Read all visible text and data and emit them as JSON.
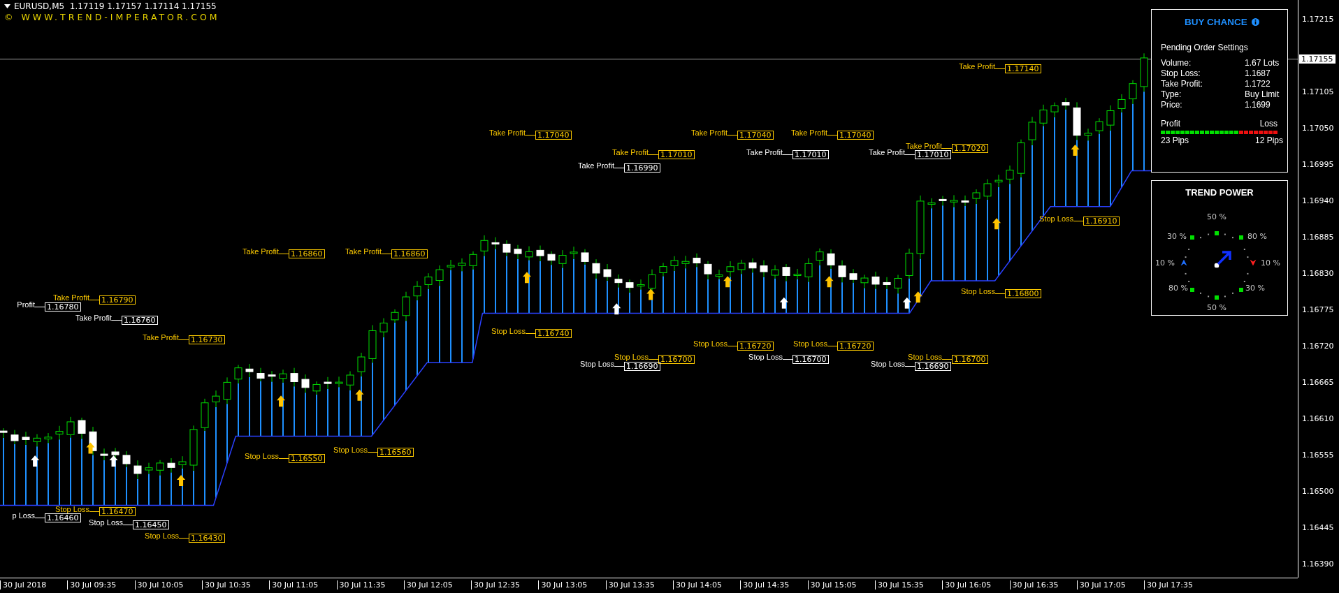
{
  "symbol_header": {
    "text": "EURUSD,M5  1.17119 1.17157 1.17114 1.17155",
    "copyright": "© WWW.TREND-IMPERATOR.COM"
  },
  "levels": [
    {
      "label": "Profit",
      "value": "1.16780",
      "color": "#ffffff"
    },
    {
      "label": "Take Profit",
      "value": "1.16790",
      "color": "#ffcc00"
    },
    {
      "label": "Take Profit",
      "value": "1.16760",
      "color": "#ffffff"
    },
    {
      "label": "Take Profit",
      "value": "1.16730",
      "color": "#ffcc00"
    },
    {
      "label": "Take Profit",
      "value": "1.16860",
      "color": "#ffcc00"
    },
    {
      "label": "Take Profit",
      "value": "1.16860",
      "color": "#ffcc00"
    },
    {
      "label": "Take Profit",
      "value": "1.17040",
      "color": "#ffcc00"
    },
    {
      "label": "Take Profit",
      "value": "1.17010",
      "color": "#ffcc00"
    },
    {
      "label": "Take Profit",
      "value": "1.16990",
      "color": "#ffffff"
    },
    {
      "label": "Take Profit",
      "value": "1.17040",
      "color": "#ffcc00"
    },
    {
      "label": "Take Profit",
      "value": "1.17010",
      "color": "#ffffff"
    },
    {
      "label": "Take Profit",
      "value": "1.17040",
      "color": "#ffcc00"
    },
    {
      "label": "Take Profit",
      "value": "1.17020",
      "color": "#ffcc00"
    },
    {
      "label": "Take Profit",
      "value": "1.17010",
      "color": "#ffffff"
    },
    {
      "label": "Take Profit",
      "value": "1.17140",
      "color": "#ffcc00"
    },
    {
      "label": "Stop Loss",
      "value": "1.16910",
      "color": "#ffcc00"
    },
    {
      "label": "p Loss",
      "value": "1.16460",
      "color": "#ffffff"
    },
    {
      "label": "Stop Loss",
      "value": "1.16470",
      "color": "#ffcc00"
    },
    {
      "label": "Stop Loss",
      "value": "1.16450",
      "color": "#ffffff"
    },
    {
      "label": "Stop Loss",
      "value": "1.16430",
      "color": "#ffcc00"
    },
    {
      "label": "Stop Loss",
      "value": "1.16550",
      "color": "#ffcc00"
    },
    {
      "label": "Stop Loss",
      "value": "1.16560",
      "color": "#ffcc00"
    },
    {
      "label": "Stop Loss",
      "value": "1.16740",
      "color": "#ffcc00"
    },
    {
      "label": "Stop Loss",
      "value": "1.16700",
      "color": "#ffcc00"
    },
    {
      "label": "Stop Loss",
      "value": "1.16690",
      "color": "#ffffff"
    },
    {
      "label": "Stop Loss",
      "value": "1.16720",
      "color": "#ffcc00"
    },
    {
      "label": "Stop Loss",
      "value": "1.16700",
      "color": "#ffffff"
    },
    {
      "label": "Stop Loss",
      "value": "1.16720",
      "color": "#ffcc00"
    },
    {
      "label": "Stop Loss",
      "value": "1.16700",
      "color": "#ffcc00"
    },
    {
      "label": "Stop Loss",
      "value": "1.16690",
      "color": "#ffffff"
    },
    {
      "label": "Stop Loss",
      "value": "1.16800",
      "color": "#ffcc00"
    }
  ],
  "buy_chance": {
    "title": "BUY CHANCE",
    "subtitle": "Pending Order Settings",
    "rows": [
      {
        "label": "Volume:",
        "value": "1.67 Lots"
      },
      {
        "label": "Stop Loss:",
        "value": "1.1687"
      },
      {
        "label": "Take Profit:",
        "value": "1.1722"
      },
      {
        "label": "Type:",
        "value": "Buy Limit"
      },
      {
        "label": "Price:",
        "value": "1.1699"
      }
    ],
    "profit_label": "Profit",
    "loss_label": "Loss",
    "level": 0.667,
    "profit_pips": "23 Pips",
    "loss_pips": "12 Pips"
  },
  "trend_power": {
    "title": "TREND POWER",
    "directions": [
      {
        "label": "50 %",
        "kind": "square",
        "color": "#00e000"
      },
      {
        "label": "80 %",
        "kind": "square",
        "color": "#00e000"
      },
      {
        "label": "10 %",
        "kind": "arrow",
        "color": "#ff2020"
      },
      {
        "label": "30 %",
        "kind": "square",
        "color": "#00e000"
      },
      {
        "label": "50 %",
        "kind": "square",
        "color": "#00e000"
      },
      {
        "label": "80 %",
        "kind": "square",
        "color": "#00e000"
      },
      {
        "label": "10 %",
        "kind": "arrow",
        "color": "#2070ff"
      },
      {
        "label": "30 %",
        "kind": "square",
        "color": "#00e000"
      }
    ]
  },
  "price_axis": {
    "labels": [
      "1.17215",
      "1.17105",
      "1.17050",
      "1.16995",
      "1.16940",
      "1.16885",
      "1.16830",
      "1.16775",
      "1.16720",
      "1.16665",
      "1.16610",
      "1.16555",
      "1.16500",
      "1.16445",
      "1.16390"
    ],
    "current_price": "1.17155"
  },
  "time_axis": {
    "labels": [
      "30 Jul 2018",
      "30 Jul 09:35",
      "30 Jul 10:05",
      "30 Jul 10:35",
      "30 Jul 11:05",
      "30 Jul 11:35",
      "30 Jul 12:05",
      "30 Jul 12:35",
      "30 Jul 13:05",
      "30 Jul 13:35",
      "30 Jul 14:05",
      "30 Jul 14:35",
      "30 Jul 15:05",
      "30 Jul 15:35",
      "30 Jul 16:05",
      "30 Jul 16:35",
      "30 Jul 17:05",
      "30 Jul 17:35"
    ]
  }
}
